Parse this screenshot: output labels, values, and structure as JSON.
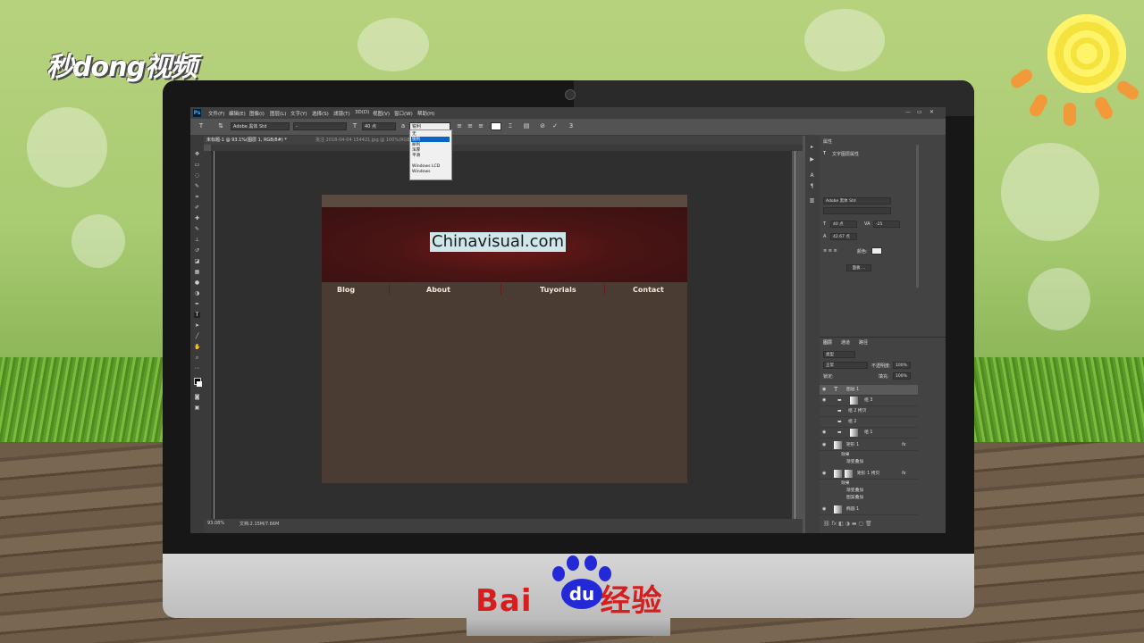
{
  "watermark_top": "秒dong视频",
  "bottom_logo": {
    "text_left": "Bai",
    "text_paw": "du",
    "text_right": "经验"
  },
  "photoshop": {
    "app_icon": "Ps",
    "menu": [
      "文件(F)",
      "编辑(E)",
      "图像(I)",
      "图层(L)",
      "文字(Y)",
      "选择(S)",
      "滤镜(T)",
      "3D(D)",
      "视图(V)",
      "窗口(W)",
      "帮助(H)"
    ],
    "window_controls": [
      "—",
      "▭",
      "✕"
    ],
    "options": {
      "tool_glyph": "T",
      "font_family": "Adobe 黑体 Std",
      "font_style": "-",
      "font_size": "40 点",
      "aa_label": "锐利"
    },
    "antialias_dropdown": {
      "items": [
        "无",
        "锐利",
        "犀利",
        "浑厚",
        "平滑",
        "Windows LCD",
        "Windows"
      ],
      "selected_index": 1
    },
    "tabs": [
      {
        "label": "未标题-1 @ 93.1%(图层 1, RGB/8#) *",
        "active": true
      },
      {
        "label": "批注 2018-04-04 154421.jpg @ 100%(RGB/8#)",
        "active": false
      }
    ],
    "status": {
      "zoom": "93.08%",
      "doc": "文档:2.15M/7.66M"
    },
    "canvas": {
      "site_title": "Chinavisual.com",
      "nav": [
        "Blog",
        "About",
        "Tuyorials",
        "Contact"
      ]
    },
    "properties_panel": {
      "tab": "属性",
      "title": "文字图层属性",
      "font_family": "Adobe 黑体 Std",
      "font_size": "40 点",
      "tracking": "-25",
      "leading": "42.67 点",
      "color_label": "颜色:",
      "button": "面板 ..."
    },
    "layers_panel": {
      "tabs": [
        "图层",
        "通道",
        "路径"
      ],
      "kind_label": "类型",
      "blend_mode": "正常",
      "opacity_label": "不透明度:",
      "opacity": "100%",
      "lock_label": "锁定:",
      "fill_label": "填充:",
      "fill": "100%",
      "layers": [
        "图层 1",
        "组 3",
        "组 2 拷贝",
        "组 2",
        "组 1",
        "矩形 1",
        "效果",
        "渐变叠加",
        "矩形 1 拷贝",
        "效果",
        "渐变叠加",
        "图案叠加",
        "椭圆 1"
      ]
    }
  }
}
